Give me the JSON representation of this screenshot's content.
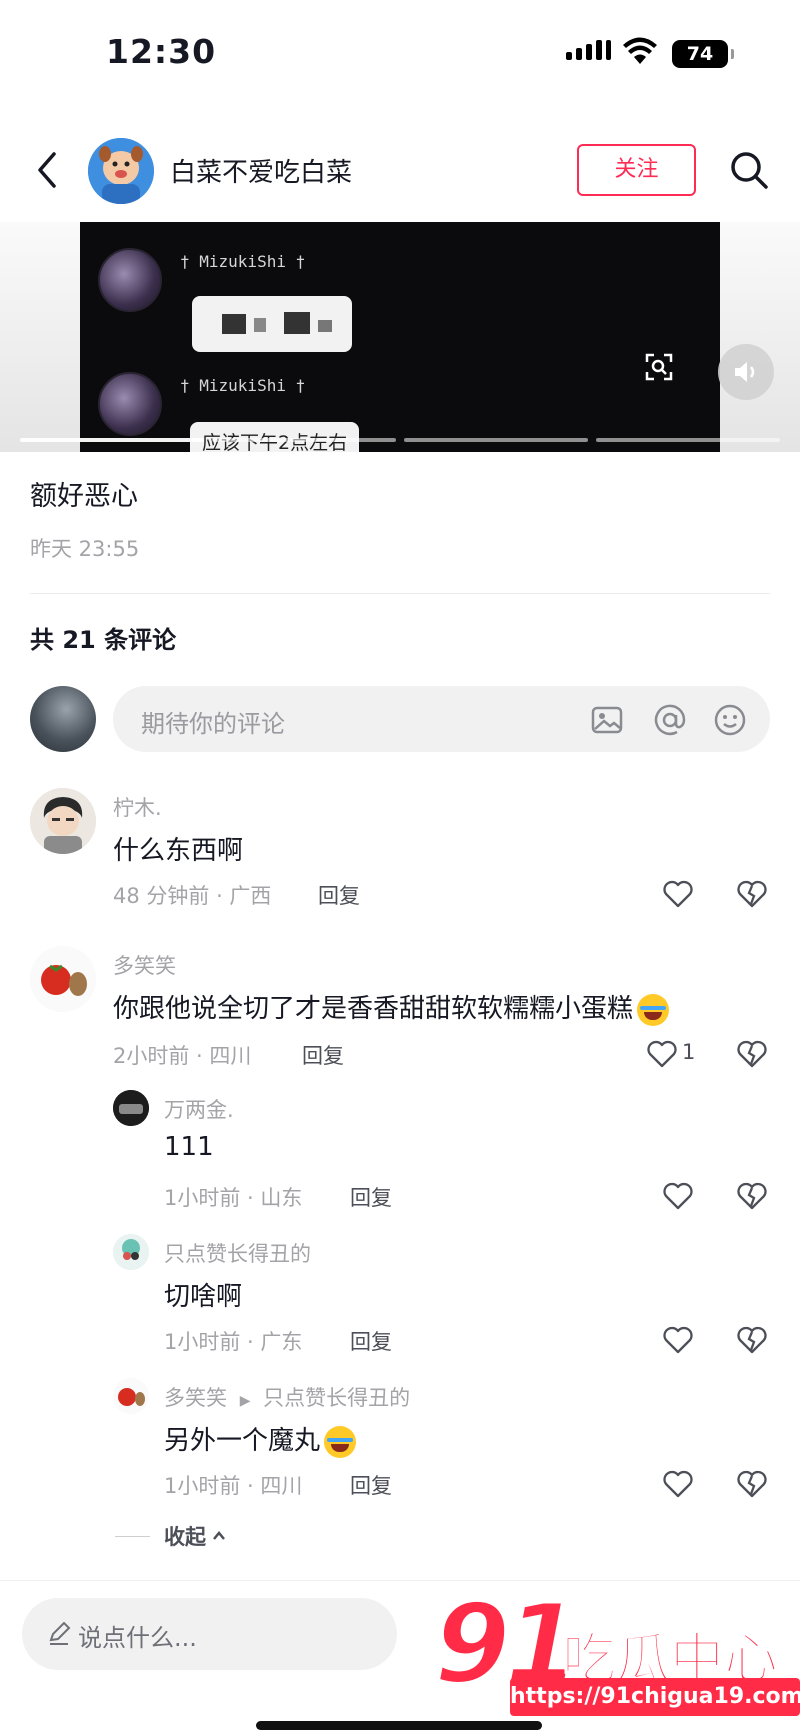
{
  "status_bar": {
    "time": "12:30",
    "battery": "74"
  },
  "header": {
    "author_name": "白菜不爱吃白菜",
    "follow_label": "关注"
  },
  "video": {
    "username_1": "† MizukiShi †",
    "username_2": "† MizukiShi †",
    "bubble_text": "应该下午2点左右"
  },
  "post": {
    "text": "额好恶心",
    "time": "昨天 23:55"
  },
  "comments_header": {
    "count_label": "共 21 条评论"
  },
  "comment_input": {
    "placeholder": "期待你的评论"
  },
  "comments": [
    {
      "user": "柠木.",
      "text": "什么东西啊",
      "meta": "48 分钟前 · 广西",
      "reply": "回复",
      "likes": ""
    },
    {
      "user": "多笑笑",
      "text": "你跟他说全切了才是香香甜甜软软糯糯小蛋糕",
      "meta": "2小时前 · 四川",
      "reply": "回复",
      "likes": "1"
    }
  ],
  "replies": [
    {
      "user": "万两金.",
      "text": "111",
      "meta": "1小时前 · 山东",
      "reply": "回复"
    },
    {
      "user": "只点赞长得丑的",
      "text": "切啥啊",
      "meta": "1小时前 · 广东",
      "reply": "回复"
    },
    {
      "user": "多笑笑",
      "reply_to": "只点赞长得丑的",
      "text": "另外一个魔丸",
      "meta": "1小时前 · 四川",
      "reply": "回复"
    }
  ],
  "collapse_label": "收起",
  "bottom_bar": {
    "placeholder": "说点什么..."
  },
  "watermark": {
    "brand_number": "91",
    "brand_text": "吃瓜中心",
    "url": "https://91chigua19.com"
  }
}
